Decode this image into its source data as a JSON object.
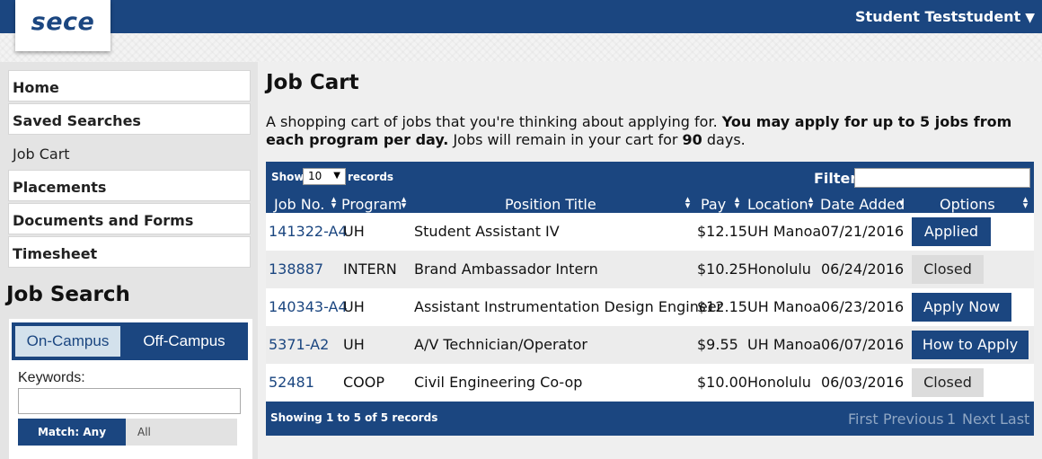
{
  "header": {
    "logo": "sece",
    "user_name": "Student Teststudent",
    "user_caret": "▼"
  },
  "sidebar": {
    "items": [
      {
        "label": "Home"
      },
      {
        "label": "Saved Searches"
      },
      {
        "label": "Job Cart"
      },
      {
        "label": "Placements"
      },
      {
        "label": "Documents and Forms"
      },
      {
        "label": "Timesheet"
      }
    ],
    "job_search": {
      "title": "Job Search",
      "tab_on_campus": "On-Campus",
      "tab_off_campus": "Off-Campus",
      "keywords_label": "Keywords:",
      "keywords_value": "",
      "match_any": "Match: Any",
      "match_all": "All"
    }
  },
  "main": {
    "title": "Job Cart",
    "intro_plain_1": "A shopping cart of jobs that you're thinking about applying for. ",
    "intro_bold_1": "You may apply for up to 5 jobs from each program per day.",
    "intro_plain_2": " Jobs will remain in your cart for ",
    "intro_bold_2": "90",
    "intro_plain_3": " days."
  },
  "table": {
    "show_label": "Show",
    "show_value": "10",
    "records_label": "records",
    "filter_label": "Filter:",
    "filter_value": "",
    "columns": {
      "job_no": "Job No.",
      "program": "Program",
      "position_title": "Position Title",
      "pay": "Pay",
      "location": "Location",
      "date_added": "Date Added",
      "options": "Options"
    },
    "rows": [
      {
        "job_no": "141322-A4",
        "program": "UH",
        "title": "Student Assistant IV",
        "pay": "$12.15",
        "location": "UH Manoa",
        "date": "07/21/2016",
        "option": "Applied"
      },
      {
        "job_no": "138887",
        "program": "INTERN",
        "title": "Brand Ambassador Intern",
        "pay": "$10.25",
        "location": "Honolulu",
        "date": "06/24/2016",
        "option": "Closed"
      },
      {
        "job_no": "140343-A4",
        "program": "UH",
        "title": "Assistant Instrumentation Design Engineer",
        "pay": "$12.15",
        "location": "UH Manoa",
        "date": "06/23/2016",
        "option": "Apply Now"
      },
      {
        "job_no": "5371-A2",
        "program": "UH",
        "title": "A/V Technician/Operator",
        "pay": "$9.55",
        "location": "UH Manoa",
        "date": "06/07/2016",
        "option": "How to Apply"
      },
      {
        "job_no": "52481",
        "program": "COOP",
        "title": "Civil Engineering Co-op",
        "pay": "$10.00",
        "location": "Honolulu",
        "date": "06/03/2016",
        "option": "Closed"
      }
    ],
    "footer": {
      "showing": "Showing 1 to 5 of 5 records",
      "first": "First",
      "previous": "Previous",
      "page": "1",
      "next": "Next",
      "last": "Last"
    }
  },
  "colors": {
    "brand": "#1b4680",
    "sidebar_bg": "#e4e4e4",
    "closed_button": "#dcdcdc"
  }
}
